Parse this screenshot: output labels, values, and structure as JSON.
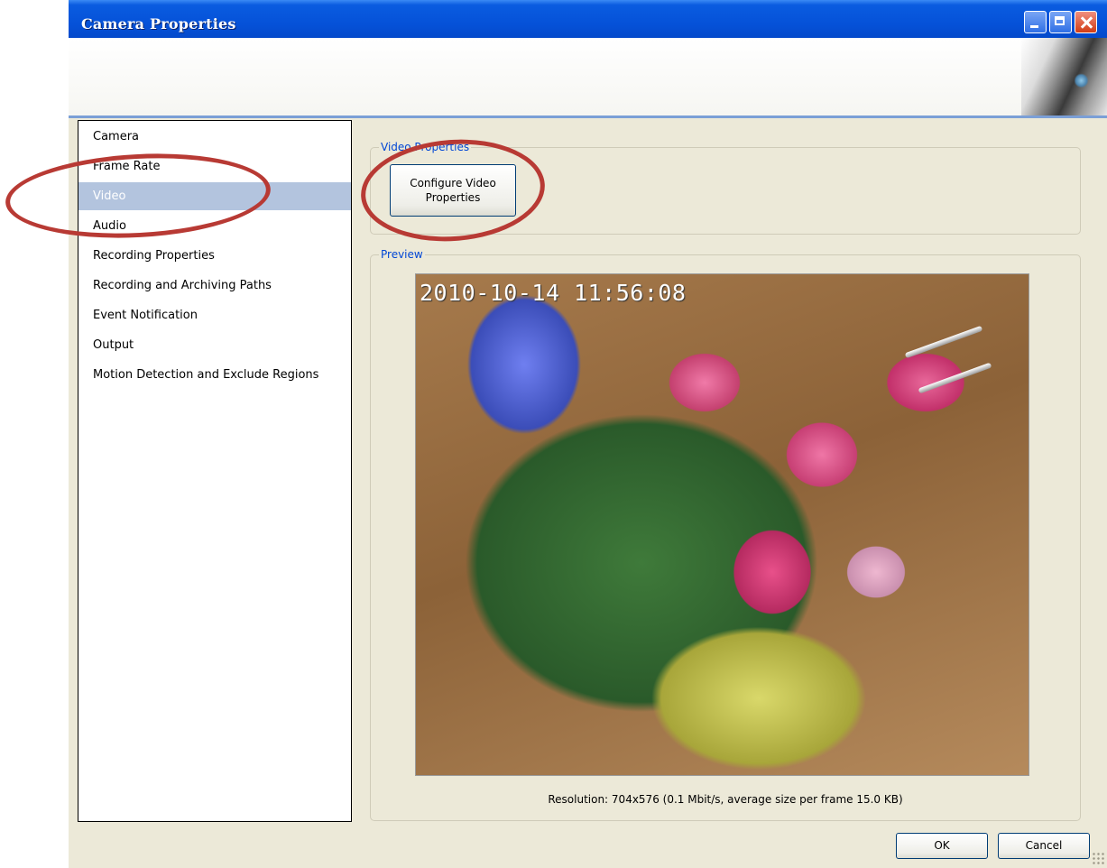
{
  "window": {
    "title": "Camera Properties"
  },
  "nav": {
    "items": [
      {
        "label": "Camera"
      },
      {
        "label": "Frame Rate"
      },
      {
        "label": "Video",
        "selected": true
      },
      {
        "label": "Audio"
      },
      {
        "label": "Recording Properties"
      },
      {
        "label": "Recording and Archiving Paths"
      },
      {
        "label": "Event Notification"
      },
      {
        "label": "Output"
      },
      {
        "label": "Motion Detection and Exclude Regions"
      }
    ]
  },
  "video_properties": {
    "group_label": "Video Properties",
    "configure_button": "Configure Video\nProperties"
  },
  "preview": {
    "group_label": "Preview",
    "timestamp": "2010-10-14 11:56:08",
    "resolution_text": "Resolution: 704x576  (0.1 Mbit/s, average size per frame 15.0 KB)"
  },
  "footer": {
    "ok_label": "OK",
    "cancel_label": "Cancel"
  },
  "colors": {
    "titlebar": "#0551d8",
    "selected_item": "#b3c4de",
    "group_label": "#0046d5",
    "highlight_ring": "#b83a34"
  }
}
